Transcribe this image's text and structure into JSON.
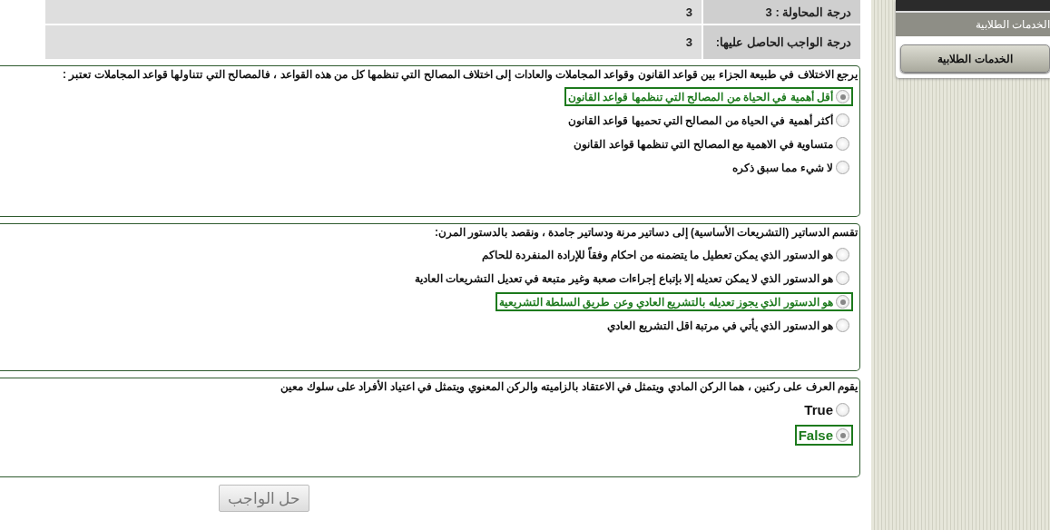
{
  "scores": [
    {
      "label": "درجة المحاولة : 3",
      "value": "3"
    },
    {
      "label": "درجة الواجب الحاصل عليها:",
      "value": "3"
    }
  ],
  "questions": [
    {
      "text": "يرجع الاختلاف في طبيعة الجزاء بين قواعد القانون وقواعد المجاملات والعادات إلى اختلاف المصالح التي تنظمها كل من هذه القواعد ، فالمصالح التي تتناولها قواعد المجاملات تعتبر :",
      "options": [
        {
          "text": "أقل أهمية في الحياة من المصالح التي تنظمها قواعد القانون",
          "selected": true
        },
        {
          "text": "أكثر أهمية في الحياة من المصالح التي تحميها قواعد القانون",
          "selected": false
        },
        {
          "text": "متساوية في الاهمية مع المصالح التي تنظمها قواعد القانون",
          "selected": false
        },
        {
          "text": "لا شيء مما سبق ذكره",
          "selected": false
        }
      ]
    },
    {
      "text": "تقسم الدساتير (التشريعات الأساسية) إلى دساتير مرنة ودساتير جامدة ، ونقصد بالدستور المرن:",
      "options": [
        {
          "text": "هو الدستور الذي يمكن تعطيل ما يتضمنه من احكام وفقاً للإرادة المنفردة للحاكم",
          "selected": false
        },
        {
          "text": "هو الدستور الذي لا يمكن تعديله إلا بإتباع إجراءات صعبة وغير متبعة في تعديل التشريعات العادية",
          "selected": false
        },
        {
          "text": "هو الدستور الذي يجوز تعديله بالتشريع العادي وعن طريق السلطة التشريعية",
          "selected": true
        },
        {
          "text": "هو الدستور الذي يأتي في مرتبة اقل التشريع العادي",
          "selected": false
        }
      ]
    },
    {
      "text": "يقوم العرف على ركنين ، هما الركن المادي ويتمثل في الاعتقاد بالزاميته والركن المعنوي ويتمثل في اعتياد الأفراد على سلوك معين",
      "options": [
        {
          "text": "True",
          "selected": false
        },
        {
          "text": "False",
          "selected": true
        }
      ]
    }
  ],
  "submit_button": "حل الواجب",
  "sidebar": {
    "title": "الخدمات الطلابية",
    "button": "الخدمات الطلابية"
  }
}
